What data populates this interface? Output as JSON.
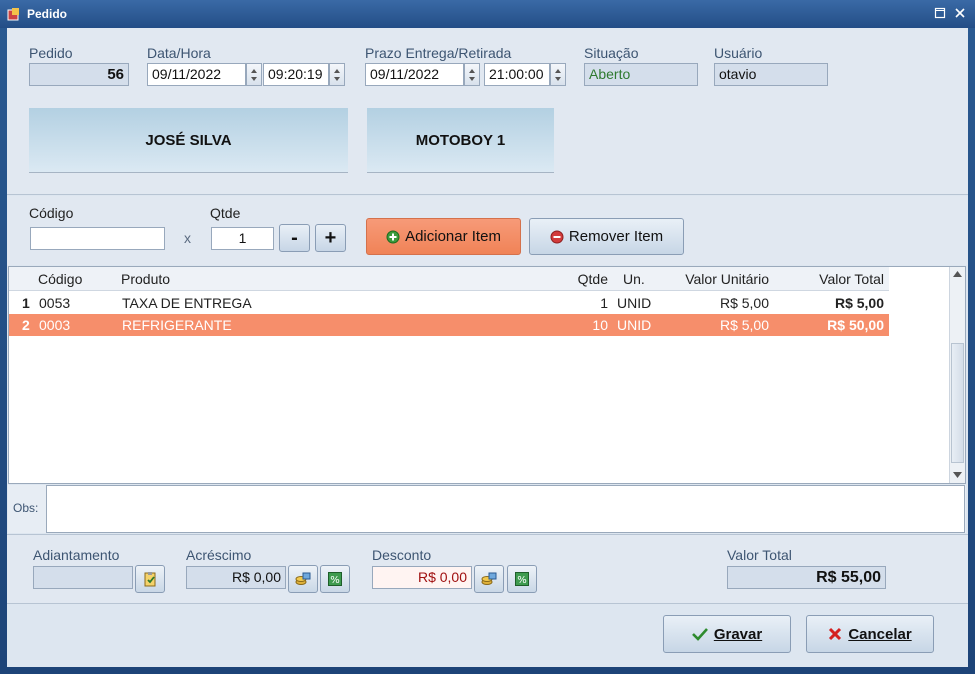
{
  "window": {
    "title": "Pedido"
  },
  "header": {
    "pedido": {
      "label": "Pedido",
      "value": "56"
    },
    "datahora": {
      "label": "Data/Hora",
      "date": "09/11/2022",
      "time": "09:20:19"
    },
    "prazo": {
      "label": "Prazo Entrega/Retirada",
      "date": "09/11/2022",
      "time": "21:00:00"
    },
    "situacao": {
      "label": "Situação",
      "value": "Aberto"
    },
    "usuario": {
      "label": "Usuário",
      "value": "otavio"
    },
    "cliente_button": "JOSÉ SILVA",
    "entregador_button": "MOTOBOY 1"
  },
  "item_entry": {
    "codigo_label": "Código",
    "codigo_value": "",
    "x_label": "x",
    "qtde_label": "Qtde",
    "qtde_value": "1",
    "minus_label": "-",
    "plus_label": "+",
    "add_label": "Adicionar Item",
    "remove_label": "Remover Item"
  },
  "grid": {
    "columns": [
      "Código",
      "Produto",
      "Qtde",
      "Un.",
      "Valor Unitário",
      "Valor Total"
    ],
    "rows": [
      {
        "num": "1",
        "codigo": "0053",
        "produto": "TAXA DE ENTREGA",
        "qtde": "1",
        "un": "UNID",
        "unit": "R$ 5,00",
        "total": "R$ 5,00"
      },
      {
        "num": "2",
        "codigo": "0003",
        "produto": "REFRIGERANTE",
        "qtde": "10",
        "un": "UNID",
        "unit": "R$ 5,00",
        "total": "R$ 50,00"
      }
    ]
  },
  "obs": {
    "label": "Obs:",
    "value": ""
  },
  "totals": {
    "adiantamento_label": "Adiantamento",
    "adiantamento_value": "",
    "acrescimo_label": "Acréscimo",
    "acrescimo_value": "R$ 0,00",
    "desconto_label": "Desconto",
    "desconto_value": "R$ 0,00",
    "valor_total_label": "Valor Total",
    "valor_total_value": "R$ 55,00"
  },
  "footer": {
    "save_label": "Gravar",
    "cancel_label": "Cancelar"
  },
  "colors": {
    "selected_row": "#f68e6b",
    "add_button": "#f08357",
    "title_bar": "#2a5a92"
  }
}
